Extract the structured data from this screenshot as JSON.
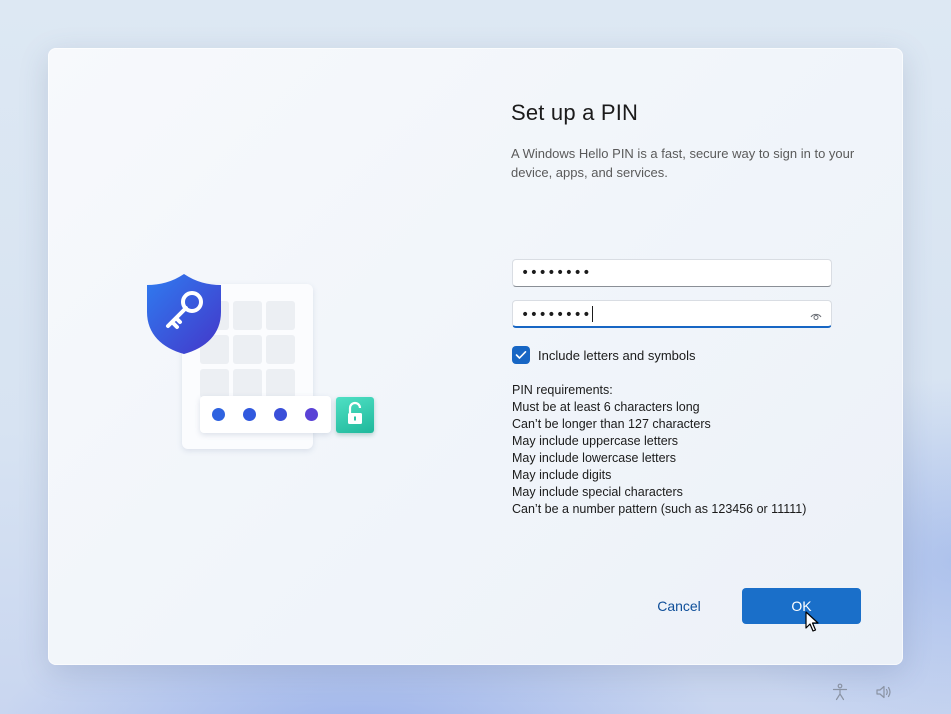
{
  "dialog": {
    "title": "Set up a PIN",
    "description": "A Windows Hello PIN is a fast, secure way to sign in to your device, apps, and services."
  },
  "fields": {
    "new_pin_value": "••••••••",
    "confirm_pin_value": "••••••••"
  },
  "checkbox": {
    "label": "Include letters and symbols",
    "checked": true
  },
  "requirements": {
    "heading": "PIN requirements:",
    "items": [
      "Must be at least 6 characters long",
      "Can’t be longer than 127 characters",
      "May include uppercase letters",
      "May include lowercase letters",
      "May include digits",
      "May include special characters",
      "Can’t be a number pattern (such as 123456 or 11111)"
    ]
  },
  "buttons": {
    "cancel": "Cancel",
    "ok": "OK"
  },
  "colors": {
    "accent": "#1a6fc9",
    "shield": "#3b5bdb",
    "lock_tile": "#2cc4a6"
  },
  "icons": {
    "shield": "shield-key-icon",
    "lock": "unlocked-padlock-icon",
    "reveal": "eye-icon",
    "accessibility": "accessibility-icon",
    "volume": "volume-icon",
    "checkmark": "checkmark-icon"
  }
}
